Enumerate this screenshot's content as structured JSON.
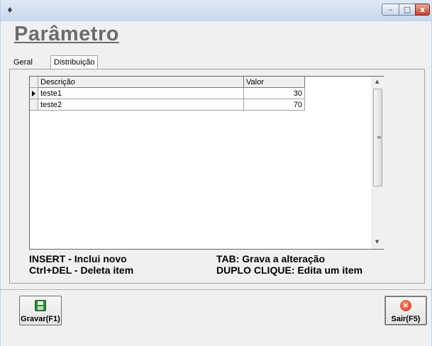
{
  "window": {
    "app_icon": "app-icon",
    "controls": {
      "minimize": "–",
      "maximize": "□",
      "close": "x"
    }
  },
  "page": {
    "title": "Parâmetro"
  },
  "tabs": [
    {
      "label": "Geral",
      "active": false
    },
    {
      "label": "Distribuição",
      "active": true
    }
  ],
  "grid": {
    "columns": [
      "Descrição",
      "Valor"
    ],
    "rows": [
      {
        "descricao": "teste1",
        "valor": "30",
        "current": true
      },
      {
        "descricao": "teste2",
        "valor": "70",
        "current": false
      }
    ],
    "scrollbar_grip": "≡"
  },
  "help": {
    "insert": "INSERT - Inclui novo",
    "delete": "Ctrl+DEL - Deleta item",
    "tab": "TAB: Grava a alteração",
    "dblclick": "DUPLO CLIQUE: Edita um item"
  },
  "buttons": {
    "save": {
      "label": "Gravar(F1)",
      "icon": "floppy-disk-icon"
    },
    "exit": {
      "label": "Sair(F5)",
      "icon": "exit-icon"
    }
  },
  "colors": {
    "title": "#6c6c6c",
    "save_icon": "#2e8b3a",
    "exit_icon": "#d0260f"
  }
}
